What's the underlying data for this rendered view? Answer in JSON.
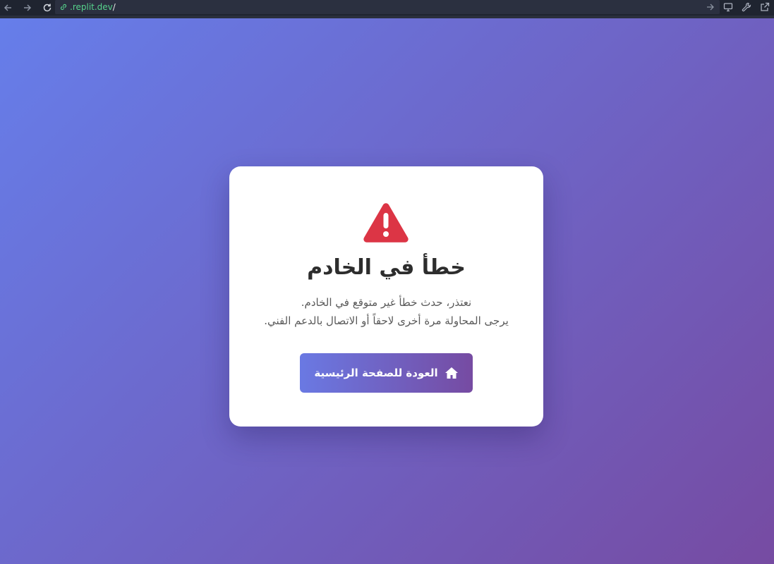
{
  "browser": {
    "url_domain": ".replit.dev",
    "url_path": "/",
    "icons": [
      "back-arrow-icon",
      "forward-arrow-icon",
      "reload-icon",
      "link-icon",
      "go-arrow-icon",
      "monitor-icon",
      "wrench-icon",
      "external-link-icon"
    ]
  },
  "page": {
    "background_gradient": [
      "#667eea",
      "#764ba2"
    ]
  },
  "error_card": {
    "icon": "warning-triangle-icon",
    "icon_color": "#dc3545",
    "title": "خطأ في الخادم",
    "message_line1": "نعتذر، حدث خطأ غير متوقع في الخادم.",
    "message_line2": "يرجى المحاولة مرة أخرى لاحقاً أو الاتصال بالدعم الفني.",
    "home_button_label": "العودة للصفحة الرئيسية",
    "home_button_icon": "home-icon"
  }
}
